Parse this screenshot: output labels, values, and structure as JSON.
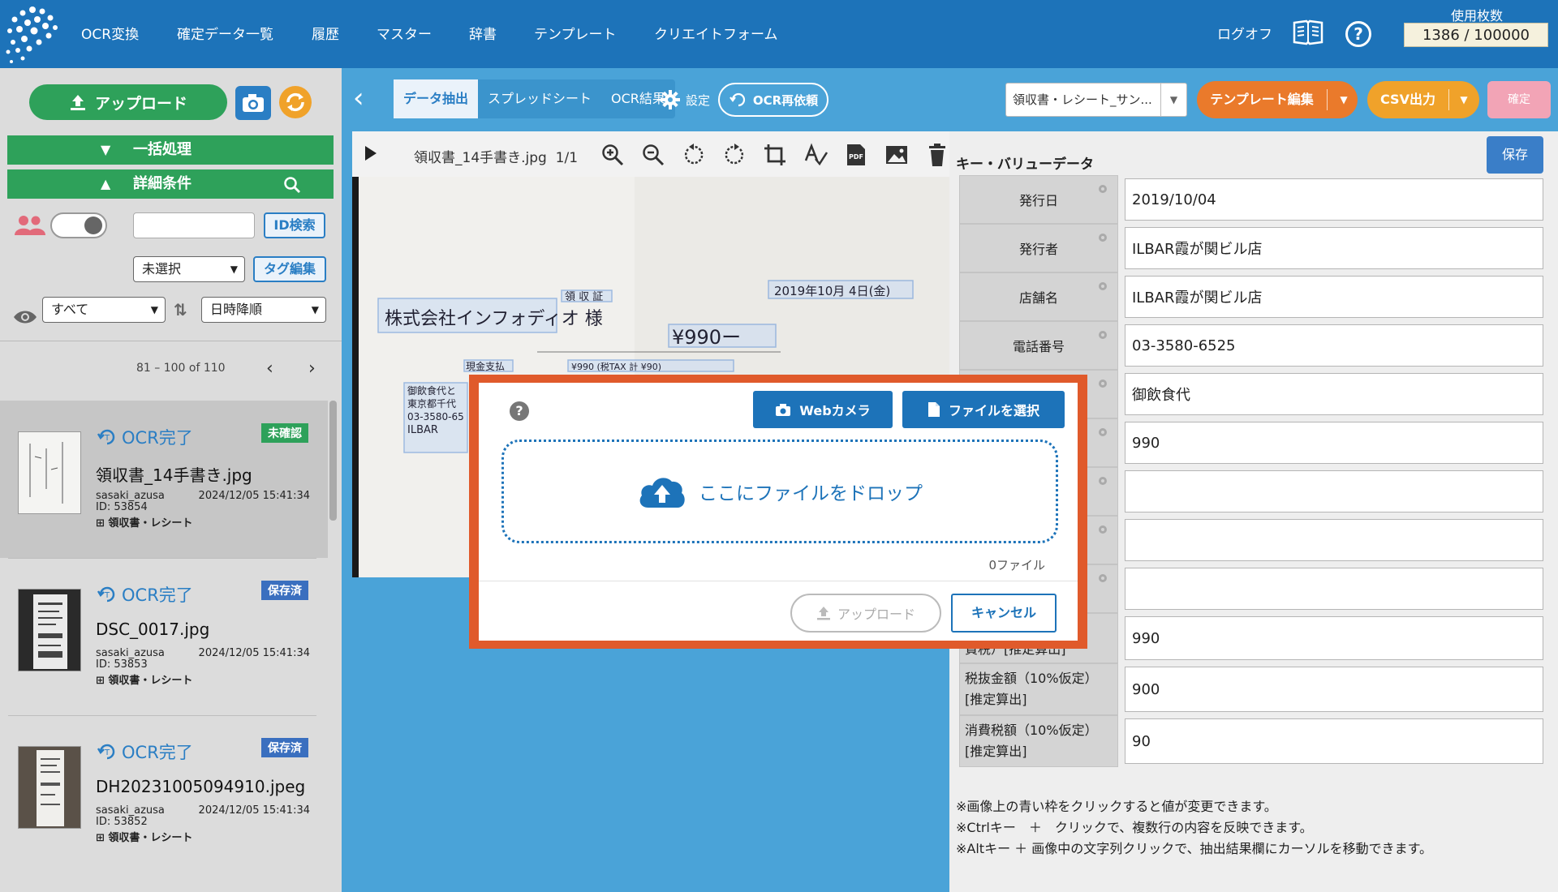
{
  "nav": {
    "items": [
      "OCR変換",
      "確定データ一覧",
      "履歴",
      "マスター",
      "辞書",
      "テンプレート",
      "クリエイトフォーム"
    ],
    "logoff": "ログオフ",
    "usage_label": "使用枚数",
    "usage_value": "1386 / 100000"
  },
  "sidebar": {
    "upload_label": "アップロード",
    "bulk_label": "一括処理",
    "detail_label": "詳細条件",
    "id_search_label": "ID検索",
    "tag_select_value": "未選択",
    "tag_edit_label": "タグ編集",
    "view_select_value": "すべて",
    "sort_select_value": "日時降順",
    "pager_text": "81 – 100 of 110"
  },
  "documents": [
    {
      "status": "OCR完了",
      "badge": "未確認",
      "filename": "領収書_14手書き.jpg",
      "user": "sasaki_azusa",
      "date": "2024/12/05 15:41:34",
      "id": "ID: 53854",
      "category": "領収書・レシート"
    },
    {
      "status": "OCR完了",
      "badge": "保存済",
      "filename": "DSC_0017.jpg",
      "user": "sasaki_azusa",
      "date": "2024/12/05 15:41:34",
      "id": "ID: 53853",
      "category": "領収書・レシート"
    },
    {
      "status": "OCR完了",
      "badge": "保存済",
      "filename": "DH20231005094910.jpeg",
      "user": "sasaki_azusa",
      "date": "2024/12/05 15:41:34",
      "id": "ID: 53852",
      "category": "領収書・レシート"
    }
  ],
  "toolbar": {
    "tabs": [
      "データ抽出",
      "スプレッドシート",
      "OCR結果"
    ],
    "settings_label": "設定",
    "ocr_redo_label": "OCR再依頼",
    "template_select_value": "領収書・レシート_サン...",
    "template_edit_label": "テンプレート編集",
    "csv_label": "CSV出力",
    "confirm_label": "確定"
  },
  "viewer": {
    "filename": "領収書_14手書き.jpg",
    "page": "1/1",
    "receipt": {
      "addressee": "株式会社インフォディオ 様",
      "title": "領 収 証",
      "date": "2019年10月 4日(金)",
      "amount": "¥990ー",
      "cash": "現金支払",
      "tax_line": "¥990 (税TAX 計 ¥90)",
      "issuer_lines": [
        "御飲食代と",
        "東京都千代",
        "03-3580-65",
        "ILBAR"
      ]
    }
  },
  "kv": {
    "title": "キー・バリューデータ",
    "save_label": "保存",
    "rows": [
      {
        "key": "発行日",
        "value": "2019/10/04"
      },
      {
        "key": "発行者",
        "value": "ILBAR霞が関ビル店"
      },
      {
        "key": "店舗名",
        "value": "ILBAR霞が関ビル店"
      },
      {
        "key": "電話番号",
        "value": "03-3580-6525"
      },
      {
        "key": "",
        "value": "御飲食代"
      },
      {
        "key": "",
        "value": "990"
      },
      {
        "key": "",
        "value": ""
      },
      {
        "key": "",
        "value": ""
      },
      {
        "key": "",
        "value": ""
      },
      {
        "key": "費税）[推定算出]",
        "value": "990"
      },
      {
        "key": "税抜金額（10%仮定）[推定算出]",
        "value": "900"
      },
      {
        "key": "消費税額（10%仮定）[推定算出]",
        "value": "90"
      }
    ],
    "notes": [
      "※画像上の青い枠をクリックすると値が変更できます。",
      "※Ctrlキー　＋　クリックで、複数行の内容を反映できます。",
      "※Altキー ＋ 画像中の文字列クリックで、抽出結果欄にカーソルを移動できます。"
    ]
  },
  "modal": {
    "webcam_label": "Webカメラ",
    "choose_file_label": "ファイルを選択",
    "drop_label": "ここにファイルをドロップ",
    "file_count": "0ファイル",
    "upload_label": "アップロード",
    "cancel_label": "キャンセル"
  }
}
